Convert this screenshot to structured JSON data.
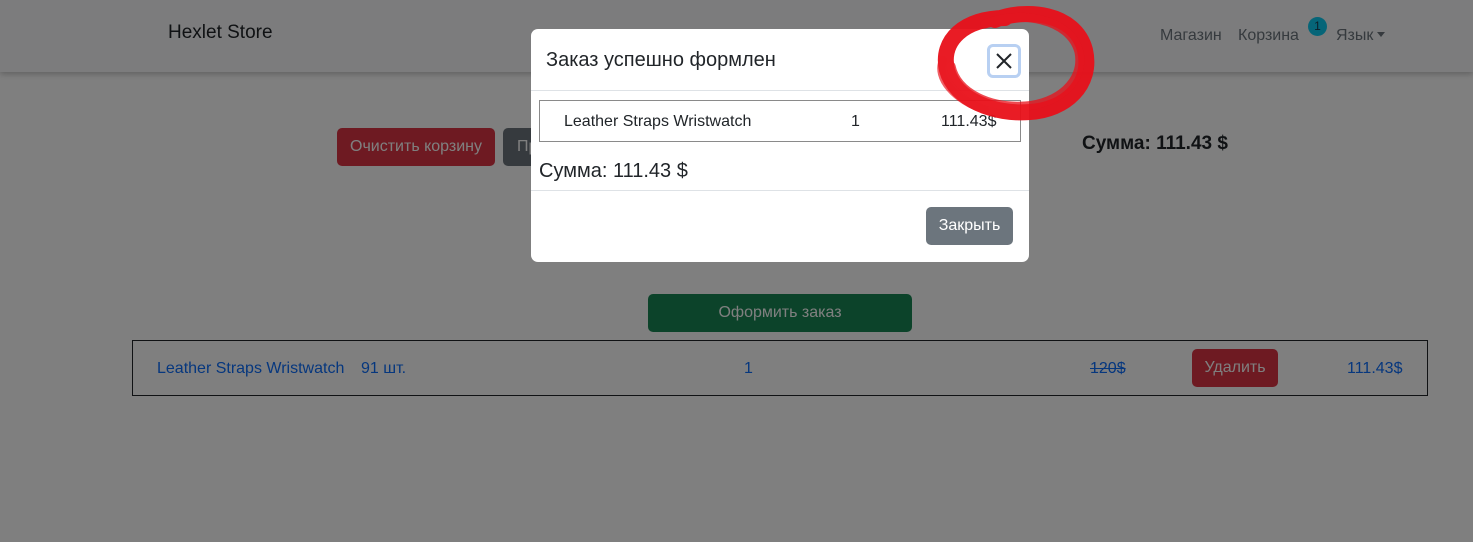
{
  "navbar": {
    "brand": "Hexlet Store",
    "shop_link": "Магазин",
    "cart_link": "Корзина",
    "cart_count": "1",
    "language_menu": "Язык"
  },
  "cart_page": {
    "clear_button": "Очистить корзину",
    "grey_button_visible_text": "Пр",
    "total": "Сумма: 111.43 $",
    "order_button": "Оформить заказ",
    "items": [
      {
        "name": "Leather Straps Wristwatch",
        "stock": "91 шт.",
        "quantity": "1",
        "old_price": "120$",
        "delete_label": "Удалить",
        "price": "111.43$"
      }
    ]
  },
  "modal": {
    "title": "Заказ успешно формлен",
    "items": [
      {
        "name": "Leather Straps Wristwatch",
        "quantity": "1",
        "price": "111.43$"
      }
    ],
    "total": "Сумма: 111.43 $",
    "close_button": "Закрыть",
    "close_icon": "close-icon"
  },
  "colors": {
    "danger": "#dc3545",
    "secondary": "#6c757d",
    "success": "#198754",
    "link": "#0d6efd",
    "badge": "#0dcaf0",
    "annotation": "#e8101a"
  }
}
